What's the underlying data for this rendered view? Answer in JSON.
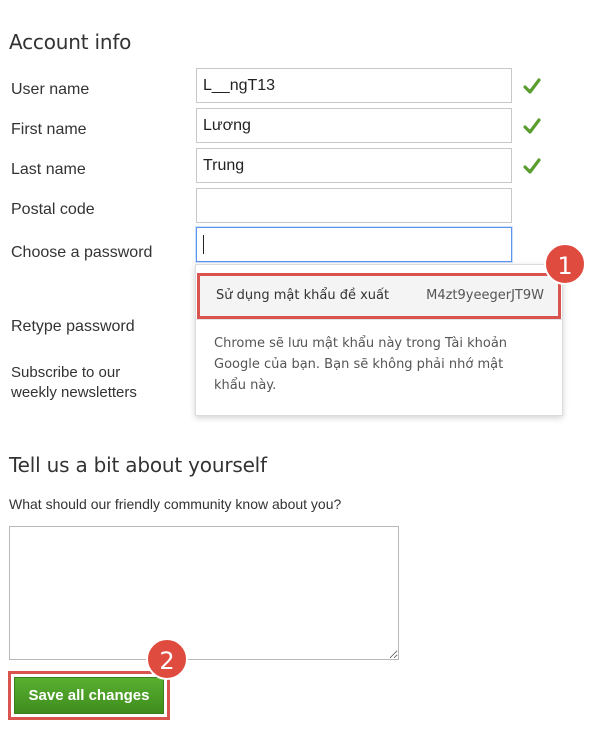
{
  "account": {
    "heading": "Account info",
    "fields": {
      "username": {
        "label": "User name",
        "value": "L__ngT13"
      },
      "first_name": {
        "label": "First name",
        "value": "Lương"
      },
      "last_name": {
        "label": "Last name",
        "value": "Trung"
      },
      "postal_code": {
        "label": "Postal code",
        "value": ""
      },
      "password": {
        "label": "Choose a password",
        "value": ""
      },
      "retype_password": {
        "label": "Retype password"
      },
      "newsletter": {
        "label_line1": "Subscribe to our",
        "label_line2": "weekly newsletters"
      }
    }
  },
  "password_suggestion": {
    "label": "Sử dụng mật khẩu đề xuất",
    "suggested_password": "M4zt9yeegerJT9W",
    "note": "Chrome sẽ lưu mật khẩu này trong Tài khoản Google của bạn. Bạn sẽ không phải nhớ mật khẩu này."
  },
  "about": {
    "heading": "Tell us a bit about yourself",
    "prompt": "What should our friendly community know about you?",
    "value": ""
  },
  "actions": {
    "save_label": "Save all changes"
  },
  "annotations": {
    "step1": "1",
    "step2": "2"
  },
  "colors": {
    "check": "#5a9e2f",
    "highlight": "#d9534f",
    "save_button": "#4a9d24",
    "badge": "#e04b3f"
  },
  "icons": {
    "valid": "check-icon"
  }
}
